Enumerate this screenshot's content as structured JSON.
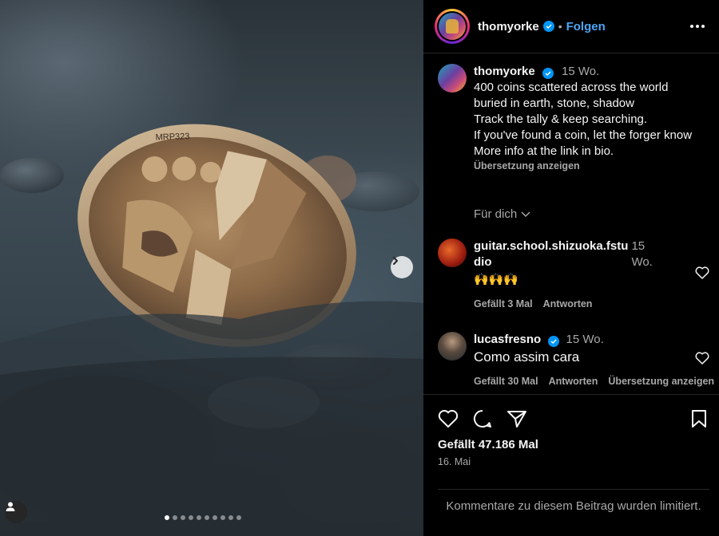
{
  "header": {
    "username": "thomyorke",
    "separator": "•",
    "follow_label": "Folgen"
  },
  "caption": {
    "username": "thomyorke",
    "age": "15 Wo.",
    "lines": [
      "400 coins scattered across the world",
      "buried in earth, stone, shadow",
      "Track the tally & keep searching.",
      "If you've found a coin, let the forger know",
      "More info at the link in bio."
    ],
    "translate_label": "Übersetzung anzeigen"
  },
  "for_you_label": "Für dich",
  "comments": [
    {
      "username": "guitar.school.shizuoka.fstudio",
      "age": "15 Wo.",
      "text": "🙌🙌🙌",
      "likes": "Gefällt 3 Mal",
      "reply_label": "Antworten"
    },
    {
      "username": "lucasfresno",
      "age": "15 Wo.",
      "text": "Como assim cara",
      "likes": "Gefällt 30 Mal",
      "reply_label": "Antworten",
      "translate_label": "Übersetzung anzeigen"
    }
  ],
  "likes_total": "Gefällt 47.186 Mal",
  "post_date": "16. Mai",
  "comments_limited": "Kommentare zu diesem Beitrag wurden limitiert.",
  "carousel": {
    "count": 10,
    "active_index": 0
  },
  "colors": {
    "follow": "#4ca5f5",
    "verified": "#0095f6",
    "muted": "#a8a8a8"
  }
}
